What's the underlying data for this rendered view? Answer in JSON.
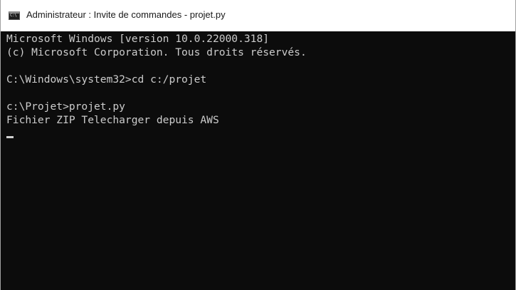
{
  "window": {
    "title": "Administrateur : Invite de commandes - projet.py",
    "icon": "cmd-icon",
    "icon_glyph": "C:\\"
  },
  "console": {
    "lines": [
      "Microsoft Windows [version 10.0.22000.318]",
      "(c) Microsoft Corporation. Tous droits réservés.",
      "",
      "C:\\Windows\\system32>cd c:/projet",
      "",
      "c:\\Projet>projet.py",
      "Fichier ZIP Telecharger depuis AWS"
    ],
    "colors": {
      "background": "#0c0c0c",
      "text": "#cccccc"
    }
  }
}
